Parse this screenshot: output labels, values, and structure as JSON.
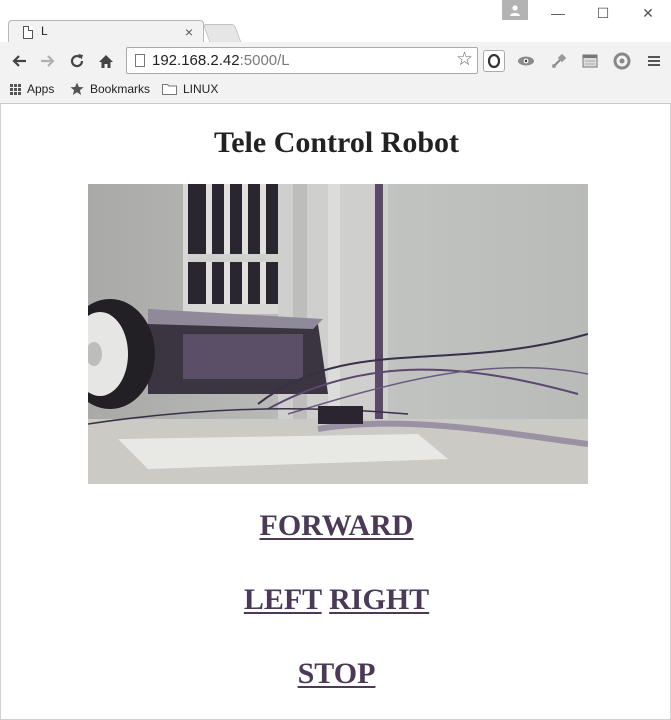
{
  "browser": {
    "tab_title": "L",
    "tab_close": "×",
    "window_controls": {
      "minimize": "—",
      "maximize": "☐",
      "close": "✕"
    },
    "url_host": "192.168.2.42",
    "url_rest": ":5000/L",
    "star": "☆",
    "bookmarks": {
      "apps": "Apps",
      "bookmarks": "Bookmarks",
      "linux": "LINUX"
    }
  },
  "page": {
    "title": "Tele Control Robot",
    "video_alt": "robot camera feed",
    "controls": {
      "forward": "FORWARD",
      "left": "LEFT",
      "right": "RIGHT",
      "stop": "STOP"
    }
  },
  "colors": {
    "link": "#4a3a58",
    "chrome_bg": "#f2f2f2"
  }
}
